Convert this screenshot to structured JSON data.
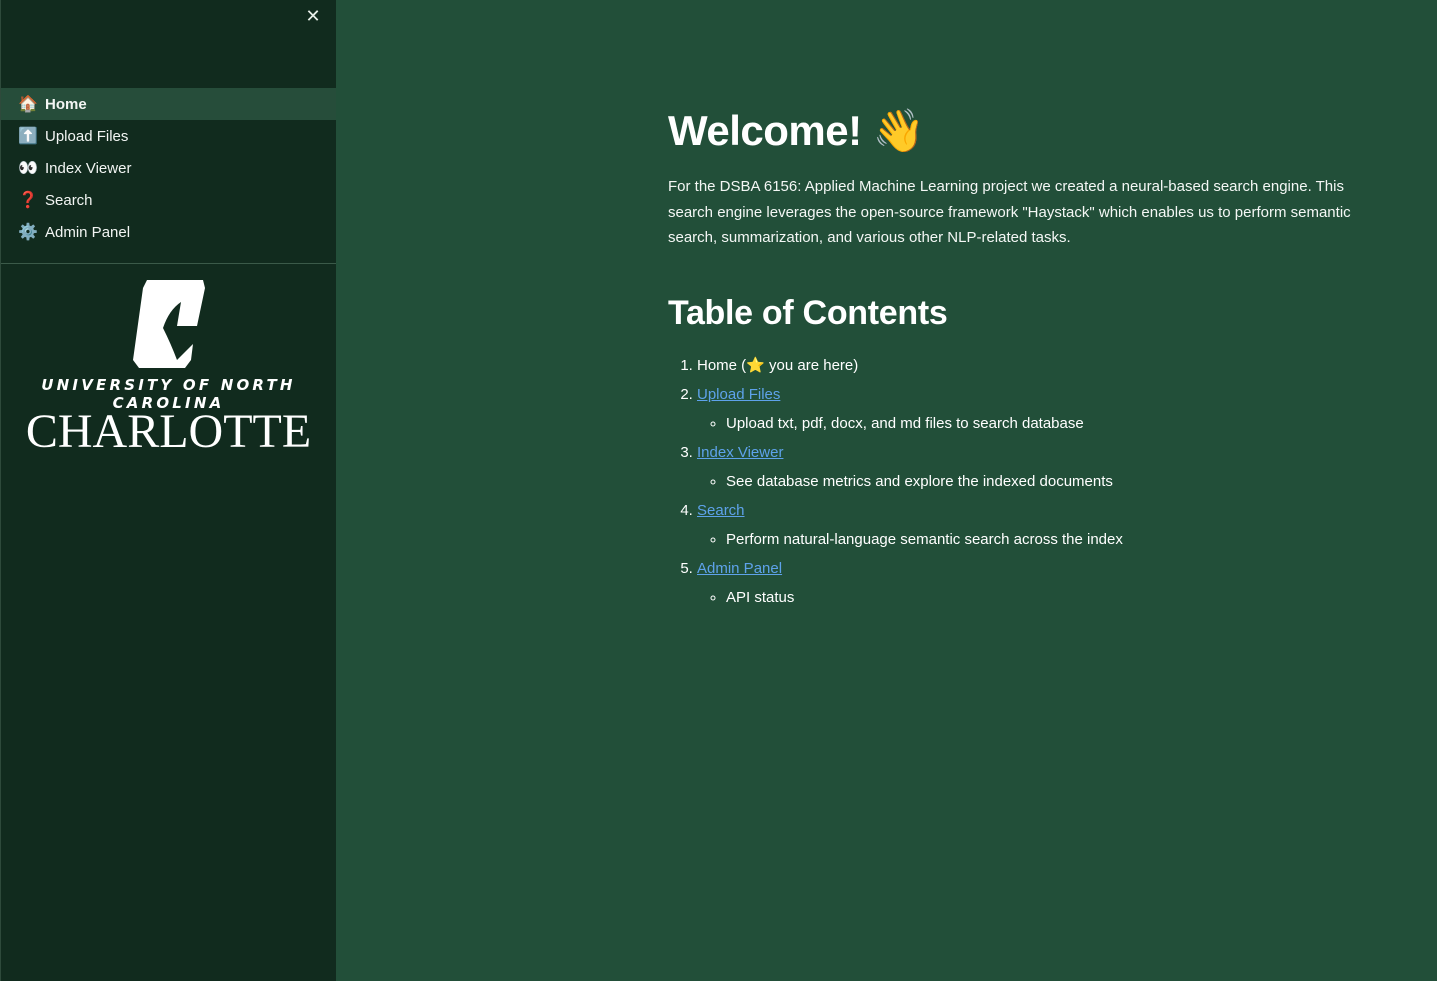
{
  "sidebar": {
    "close_icon": "✕",
    "nav_items": [
      {
        "icon": "🏠",
        "icon_name": "house",
        "label": "Home",
        "active": true
      },
      {
        "icon": "⬆️",
        "icon_name": "up-arrow",
        "label": "Upload Files",
        "active": false
      },
      {
        "icon": "👀",
        "icon_name": "eyes",
        "label": "Index Viewer",
        "active": false
      },
      {
        "icon": "❓",
        "icon_name": "question-mark",
        "label": "Search",
        "active": false
      },
      {
        "icon": "⚙️",
        "icon_name": "gear",
        "label": "Admin Panel",
        "active": false
      }
    ],
    "logo": {
      "university_line": "UNIVERSITY OF NORTH CAROLINA",
      "name_line": "CHARLOTTE"
    }
  },
  "main": {
    "title": "Welcome!",
    "title_emoji": "👋",
    "intro": "For the DSBA 6156: Applied Machine Learning project we created a neural-based search engine. This search engine leverages the open-source framework \"Haystack\" which enables us to perform semantic search, summarization, and various other NLP-related tasks.",
    "toc_heading": "Table of Contents",
    "toc": {
      "home_prefix": "Home (",
      "home_star": "⭐",
      "home_suffix": " you are here)",
      "items": [
        {
          "label": "Upload Files",
          "desc": "Upload txt, pdf, docx, and md files to search database"
        },
        {
          "label": "Index Viewer",
          "desc": "See database metrics and explore the indexed documents"
        },
        {
          "label": "Search",
          "desc": "Perform natural-language semantic search across the index"
        },
        {
          "label": "Admin Panel",
          "desc": "API status"
        }
      ]
    }
  },
  "colors": {
    "sidebar_bg": "#112b1e",
    "main_bg": "#224f39",
    "active_item_bg": "#264d3a",
    "link": "#5ea2ea"
  }
}
